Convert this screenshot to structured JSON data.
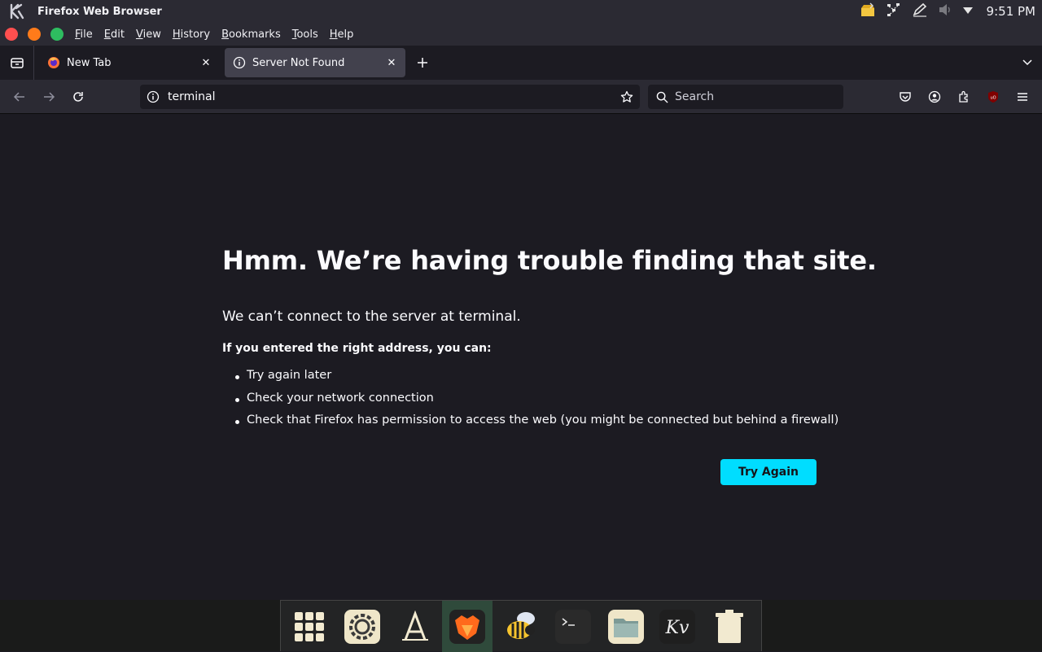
{
  "system_bar": {
    "app_title": "Firefox Web Browser",
    "clock": "9:51 PM",
    "tray_icons": [
      "package-updates-icon",
      "network-icon",
      "pen-icon",
      "volume-muted-icon",
      "dropdown-arrow-icon"
    ]
  },
  "menubar": {
    "items": [
      {
        "label": "File",
        "accel": "F",
        "rest": "ile"
      },
      {
        "label": "Edit",
        "accel": "E",
        "rest": "dit"
      },
      {
        "label": "View",
        "accel": "V",
        "rest": "iew"
      },
      {
        "label": "History",
        "accel": "H",
        "rest": "istory"
      },
      {
        "label": "Bookmarks",
        "accel": "B",
        "rest": "ookmarks"
      },
      {
        "label": "Tools",
        "accel": "T",
        "rest": "ools"
      },
      {
        "label": "Help",
        "accel": "H",
        "rest": "elp"
      }
    ],
    "window_buttons": {
      "close_color": "#ff4f4f",
      "minimize_color": "#ff7b1a",
      "maximize_color": "#2ebd60"
    }
  },
  "tabs": [
    {
      "label": "New Tab",
      "icon": "firefox-icon",
      "active": false
    },
    {
      "label": "Server Not Found",
      "icon": "info-icon",
      "active": true
    }
  ],
  "navbar": {
    "url": "terminal",
    "search_placeholder": "Search"
  },
  "error_page": {
    "title": "Hmm. We’re having trouble finding that site.",
    "description": "We can’t connect to the server at terminal.",
    "subtitle": "If you entered the right address, you can:",
    "suggestions": [
      "Try again later",
      "Check your network connection",
      "Check that Firefox has permission to access the web (you might be connected but behind a firewall)"
    ],
    "try_again_label": "Try Again",
    "accent_color": "#00ddff"
  },
  "dock": {
    "items": [
      {
        "name": "app-grid-icon",
        "active": false
      },
      {
        "name": "settings-icon",
        "active": false
      },
      {
        "name": "font-app-icon",
        "active": false
      },
      {
        "name": "firefox-dock-icon",
        "active": true
      },
      {
        "name": "bee-app-icon",
        "active": false
      },
      {
        "name": "terminal-icon",
        "active": false
      },
      {
        "name": "files-icon",
        "active": false
      },
      {
        "name": "kv-app-icon",
        "active": false
      },
      {
        "name": "trash-icon",
        "active": false
      }
    ]
  }
}
